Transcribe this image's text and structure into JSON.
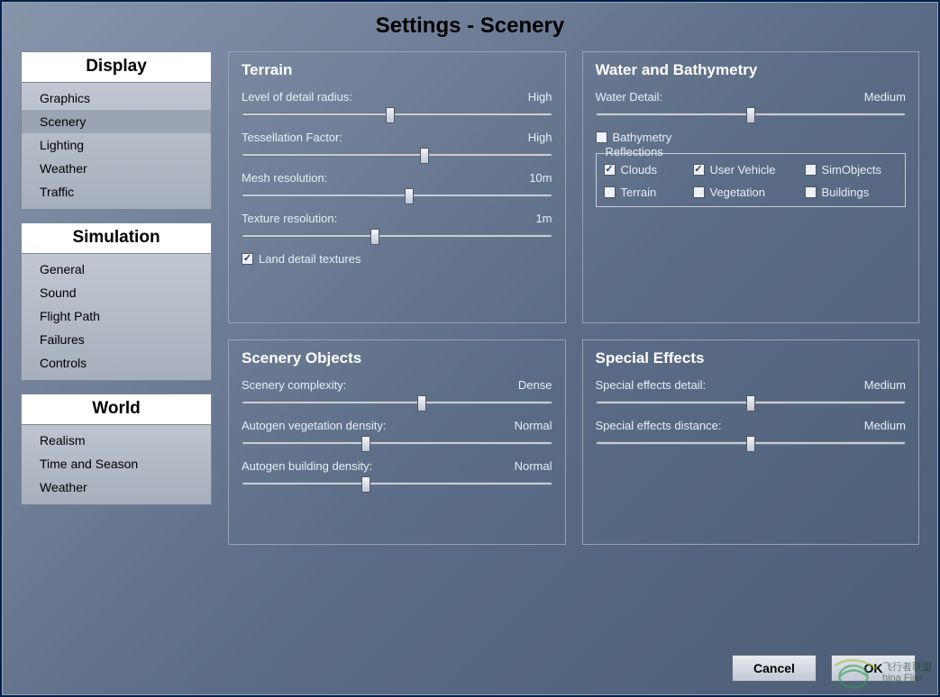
{
  "title": "Settings - Scenery",
  "sidebar": {
    "headers": {
      "display": "Display",
      "simulation": "Simulation",
      "world": "World"
    },
    "display": [
      "Graphics",
      "Scenery",
      "Lighting",
      "Weather",
      "Traffic"
    ],
    "simulation": [
      "General",
      "Sound",
      "Flight Path",
      "Failures",
      "Controls"
    ],
    "world": [
      "Realism",
      "Time and Season",
      "Weather"
    ],
    "active": "Scenery"
  },
  "panels": {
    "terrain": {
      "title": "Terrain",
      "settings": [
        {
          "label": "Level of detail radius:",
          "value": "High",
          "pos": 48
        },
        {
          "label": "Tessellation Factor:",
          "value": "High",
          "pos": 59
        },
        {
          "label": "Mesh resolution:",
          "value": "10m",
          "pos": 54
        },
        {
          "label": "Texture resolution:",
          "value": "1m",
          "pos": 43
        }
      ],
      "check": {
        "label": "Land detail textures",
        "checked": true
      }
    },
    "water": {
      "title": "Water and Bathymetry",
      "detail": {
        "label": "Water Detail:",
        "value": "Medium",
        "pos": 50
      },
      "bathy": {
        "label": "Bathymetry",
        "checked": false
      },
      "reflections": {
        "legend": "Reflections",
        "items": [
          {
            "label": "Clouds",
            "checked": true
          },
          {
            "label": "User Vehicle",
            "checked": true
          },
          {
            "label": "SimObjects",
            "checked": false
          },
          {
            "label": "Terrain",
            "checked": false
          },
          {
            "label": "Vegetation",
            "checked": false
          },
          {
            "label": "Buildings",
            "checked": false
          }
        ]
      }
    },
    "scenery_objects": {
      "title": "Scenery Objects",
      "settings": [
        {
          "label": "Scenery complexity:",
          "value": "Dense",
          "pos": 58
        },
        {
          "label": "Autogen vegetation density:",
          "value": "Normal",
          "pos": 40
        },
        {
          "label": "Autogen building density:",
          "value": "Normal",
          "pos": 40
        }
      ]
    },
    "effects": {
      "title": "Special Effects",
      "settings": [
        {
          "label": "Special effects detail:",
          "value": "Medium",
          "pos": 50
        },
        {
          "label": "Special effects distance:",
          "value": "Medium",
          "pos": 50
        }
      ]
    }
  },
  "footer": {
    "cancel": "Cancel",
    "ok": "OK"
  },
  "watermark": {
    "line1": "飞行者联盟",
    "line2": "hina Flier"
  }
}
